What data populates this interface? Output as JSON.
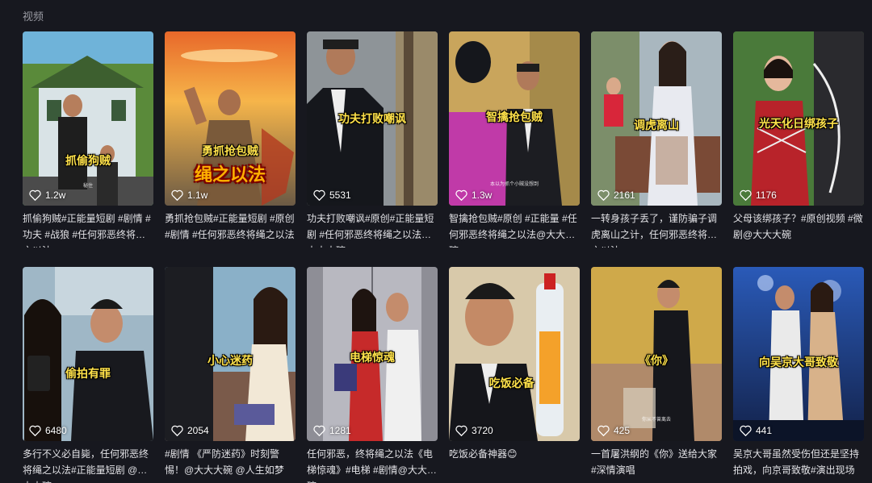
{
  "section": {
    "title": "视频"
  },
  "videos": [
    {
      "caption": "抓偷狗贼",
      "subtext": "秘住",
      "likes": "1.2w",
      "desc": "抓偷狗贼#正能量短剧 #剧情 #功夫 #战狼 #任何邪恶终将绳之以法"
    },
    {
      "caption": "勇抓抢包贼",
      "caption_big": "绳之以法",
      "likes": "1.1w",
      "desc": "勇抓抢包贼#正能量短剧 #原创 #剧情 #任何邪恶终将绳之以法"
    },
    {
      "caption": "功夫打败嘲讽",
      "likes": "5531",
      "desc": "功夫打败嘲讽#原创#正能量短剧 #任何邪恶终将绳之以法@大大大碗"
    },
    {
      "caption": "智擒抢包贼",
      "subtext": "本以为抓个小贼没想到",
      "likes": "1.3w",
      "desc": "智擒抢包贼#原创 #正能量 #任何邪恶终将绳之以法@大大大碗"
    },
    {
      "caption": "调虎离山",
      "likes": "2161",
      "desc": "一转身孩子丢了，谨防骗子调虎离山之计，任何邪恶终将绳之以法"
    },
    {
      "caption": "光天化日绑孩子",
      "likes": "1176",
      "desc": "父母该绑孩子？#原创视频 #微剧@大大大碗"
    },
    {
      "caption": "偷拍有罪",
      "likes": "6480",
      "desc": "多行不义必自毙，任何邪恶终将绳之以法#正能量短剧 @大大大碗"
    },
    {
      "caption": "小心迷药",
      "likes": "2054",
      "desc": "#剧情 《严防迷药》时刻警惕！@大大大碗 @人生如梦"
    },
    {
      "caption": "电梯惊魂",
      "likes": "1281",
      "desc": "任何邪恶，终将绳之以法《电梯惊魂》#电梯 #剧情@大大大碗"
    },
    {
      "caption": "吃饭必备",
      "likes": "3720",
      "desc": "吃饭必备神器😊"
    },
    {
      "caption": "《你》",
      "subtext": "你从不曾离去",
      "likes": "425",
      "desc": "一首屠洪纲的《你》送给大家 #深情演唱"
    },
    {
      "caption": "向吴京大哥致敬",
      "likes": "441",
      "desc": "吴京大哥虽然受伤但还是坚持拍戏，向京哥致敬#演出现场"
    }
  ],
  "colors": {
    "background": "#17181f",
    "caption_yellow": "#ffe24a"
  }
}
